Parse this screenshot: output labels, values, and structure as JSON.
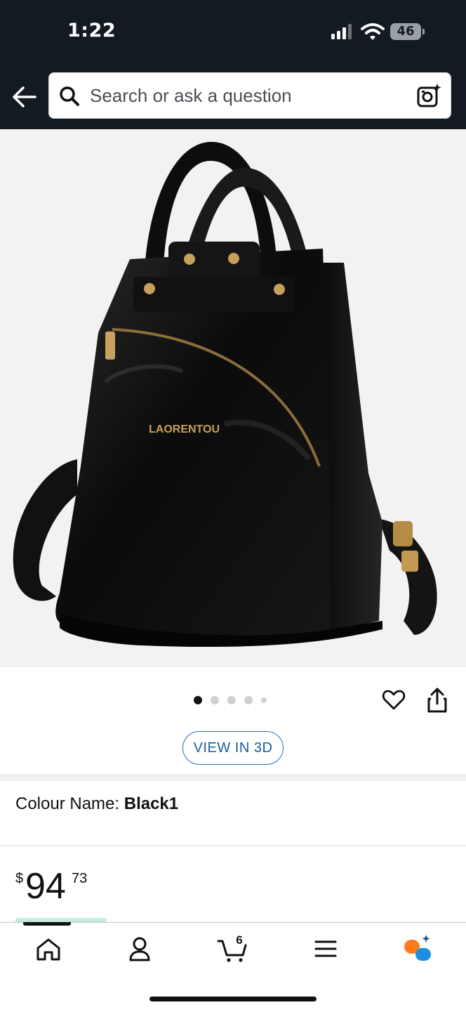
{
  "status_bar": {
    "time": "1:22",
    "battery": "46"
  },
  "search": {
    "placeholder": "Search or ask a question"
  },
  "product": {
    "image_brand_text": "LAORENTOU",
    "image_count": 5,
    "active_image_index": 0,
    "view_3d_label": "VIEW IN 3D",
    "colour_label": "Colour Name:",
    "colour_value": "Black1",
    "price": {
      "symbol": "$",
      "whole": "94",
      "fraction": "73"
    }
  },
  "bottom_nav": {
    "items": [
      {
        "name": "home",
        "icon": "home-icon"
      },
      {
        "name": "account",
        "icon": "person-icon"
      },
      {
        "name": "cart",
        "icon": "cart-icon"
      },
      {
        "name": "menu",
        "icon": "hamburger-menu-icon"
      },
      {
        "name": "rufus",
        "icon": "rufus-assistant-icon"
      }
    ],
    "cart_count": "6"
  },
  "colors": {
    "header_bg": "#131a22",
    "link_blue": "#1a5e9e",
    "rufus_orange": "#ff7a1a",
    "rufus_blue": "#1d8fe0"
  }
}
